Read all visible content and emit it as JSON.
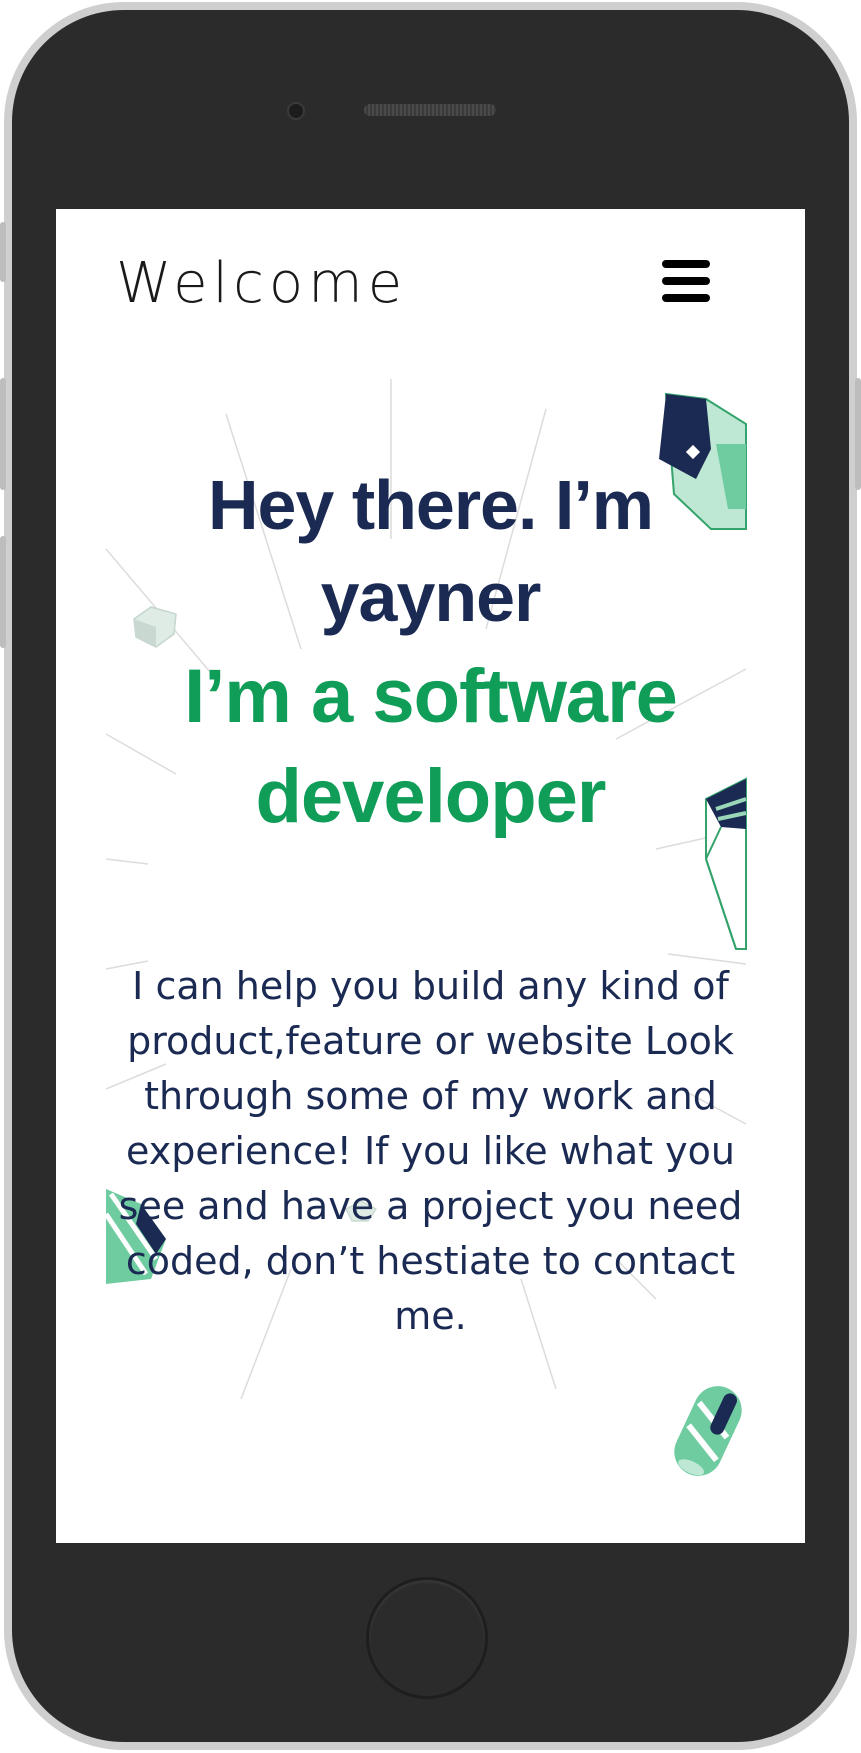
{
  "header": {
    "brand": "Welcome",
    "menu_icon": "hamburger-menu-icon"
  },
  "hero": {
    "title": "Hey there. I’m yayner",
    "role": "I’m a software developer"
  },
  "intro": {
    "text": "I can help you build any kind of product,feature or website Look through some of my work and experience! If you like what you see and have a project you need coded, don’t hestiate to contact me."
  },
  "colors": {
    "navy": "#1a2a52",
    "green": "#0f9d58",
    "mint": "#bfe8d4"
  },
  "decor_icons": [
    "cube-shape-icon",
    "small-box-icon",
    "gem-shape-icon",
    "striped-prism-icon",
    "cylinder-shape-icon"
  ]
}
